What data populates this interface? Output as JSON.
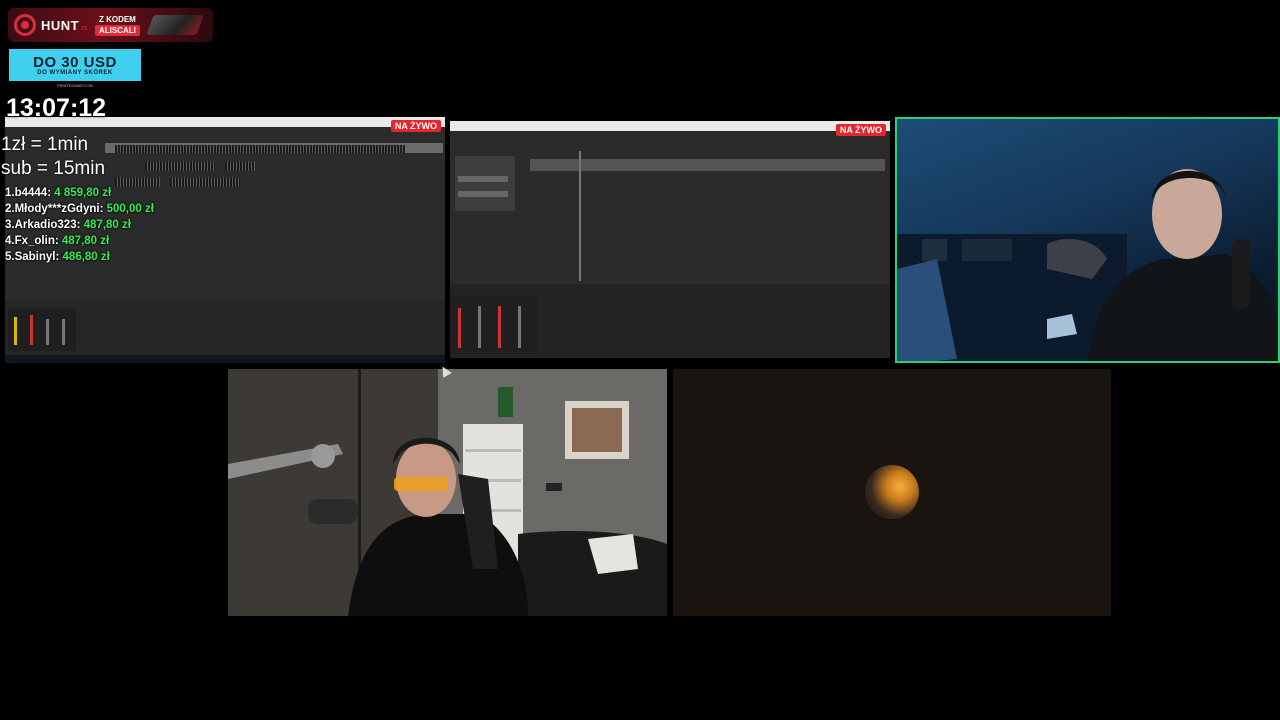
{
  "promo": {
    "brand": "HUNT",
    "brand_suffix": "rs",
    "code_line1": "Z KODEM",
    "code_line2": "ALISCALI"
  },
  "usd_banner": {
    "headline": "DO 30 USD",
    "subline": "DO WYMIANY SKÓREK",
    "site": "PIRATESWAP.COM"
  },
  "clock": "13:07:12",
  "rates": {
    "line1": "1zł = 1min",
    "line2": "sub = 15min"
  },
  "leaderboard": [
    {
      "rank": "1.",
      "name": "b4444:",
      "amount": "4 859,80 zł"
    },
    {
      "rank": "2.",
      "name": "Młody***zGdyni:",
      "amount": "500,00 zł"
    },
    {
      "rank": "3.",
      "name": "Arkadio323:",
      "amount": "487,80 zł"
    },
    {
      "rank": "4.",
      "name": "Fx_olin:",
      "amount": "487,80 zł"
    },
    {
      "rank": "5.",
      "name": "Sabinyl:",
      "amount": "486,80 zł"
    }
  ],
  "screens": {
    "left_live_badge": "NA ŻYWO",
    "middle_live_badge": "NA ŻYWO"
  },
  "colors": {
    "live_badge": "#e8252b",
    "leader_amount": "#33ee55",
    "active_speaker_border": "#27d17a",
    "usd_banner_bg": "#3fd0f0"
  }
}
